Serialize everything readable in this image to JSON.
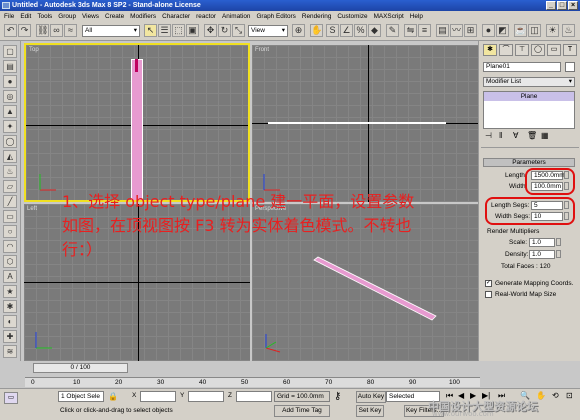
{
  "window": {
    "title": "Untitled - Autodesk 3ds Max 8 SP2 - Stand-alone License"
  },
  "menu": [
    "File",
    "Edit",
    "Tools",
    "Group",
    "Views",
    "Create",
    "Modifiers",
    "Character",
    "reactor",
    "Animation",
    "Graph Editors",
    "Rendering",
    "Customize",
    "MAXScript",
    "Help"
  ],
  "toolbar": {
    "selection_filter": "All",
    "coord_system": "View"
  },
  "viewports": {
    "top": "Top",
    "front": "Front",
    "left": "Left",
    "perspective": "Perspective"
  },
  "command_panel": {
    "object_name": "Plane01",
    "modifier_list": "Modifier List",
    "stack_item": "Plane",
    "rollout_title": "Parameters",
    "length_label": "Length:",
    "length_value": "1500.0mm",
    "width_label": "Width:",
    "width_value": "100.0mm",
    "length_segs_label": "Length Segs:",
    "length_segs_value": "5",
    "width_segs_label": "Width Segs:",
    "width_segs_value": "10",
    "render_mult_title": "Render Multipliers",
    "scale_label": "Scale:",
    "scale_value": "1.0",
    "density_label": "Density:",
    "density_value": "1.0",
    "total_faces": "Total Faces : 120",
    "gen_mapping_label": "Generate Mapping Coords.",
    "realworld_label": "Real-World Map Size"
  },
  "timeline": {
    "frame": "0 / 100",
    "ticks": [
      "0",
      "10",
      "20",
      "30",
      "40",
      "50",
      "60",
      "70",
      "80",
      "90",
      "100"
    ]
  },
  "status": {
    "selection": "1 Object Sele",
    "prompt": "Click or click-and-drag to select objects",
    "x_label": "X",
    "y_label": "Y",
    "z_label": "Z",
    "grid": "Grid = 100.0mm",
    "add_time_tag": "Add Time Tag",
    "auto_key": "Auto Key",
    "set_key": "Set Key",
    "selected": "Selected",
    "key_filters": "Key Filters..."
  },
  "annotation": "1、选择 object type/plane 建一平面，设置参数如图，在顶视图按 F3 转为实体着色模式。不转也行：）",
  "watermark": {
    "text": "中国设计大型资源论坛",
    "url": "www.ourwoo.com"
  }
}
